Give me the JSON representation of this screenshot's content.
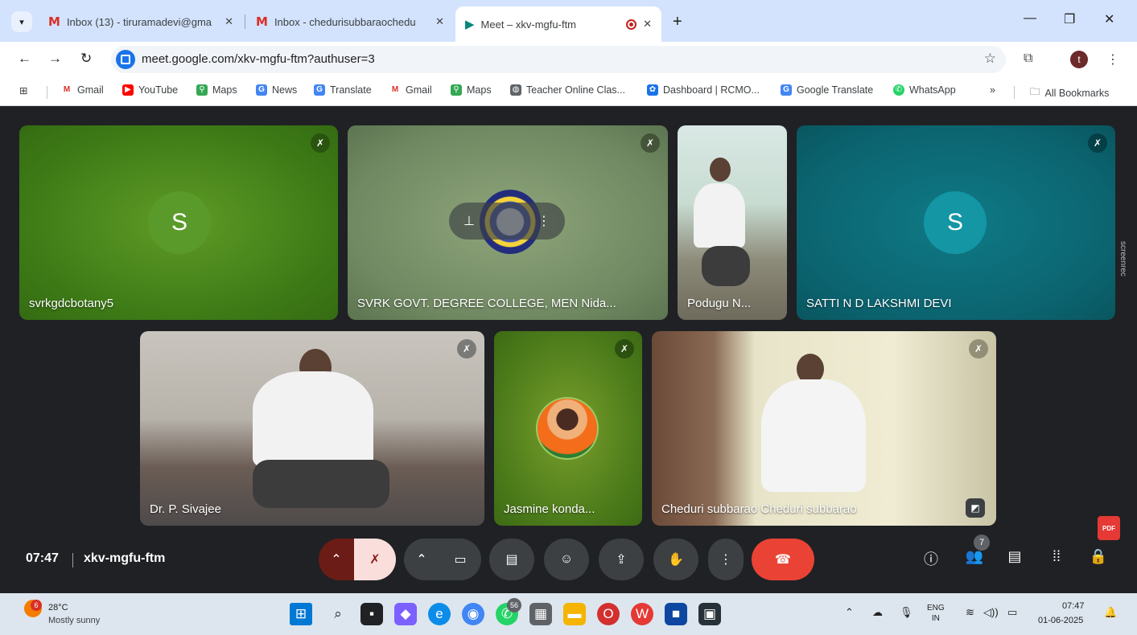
{
  "browser": {
    "tabs": [
      {
        "label": "Inbox (13) - tiruramadevi@gma",
        "icon": "gmail-icon"
      },
      {
        "label": "Inbox - chedurisubbaraochedu",
        "icon": "gmail-icon"
      },
      {
        "label": "Meet – xkv-mgfu-ftm",
        "icon": "meet-icon",
        "active": true,
        "recording": true
      }
    ],
    "url": "meet.google.com/xkv-mgfu-ftm?authuser=3",
    "profile_initial": "t",
    "bookmarks": [
      "Gmail",
      "YouTube",
      "Maps",
      "News",
      "Translate",
      "Gmail",
      "Maps",
      "Teacher Online Clas...",
      "Dashboard | RCMO...",
      "Google Translate",
      "WhatsApp"
    ],
    "bookmarks_more": "»",
    "all_bookmarks": "All Bookmarks"
  },
  "meet": {
    "participants": [
      {
        "name": "svrkgdcbotany5",
        "avatar_letter": "S",
        "muted": true
      },
      {
        "name": "SVRK GOVT. DEGREE COLLEGE, MEN Nida...",
        "muted": true
      },
      {
        "name": "Podugu N...",
        "muted": false
      },
      {
        "name": "SATTI N D LAKSHMI DEVI",
        "avatar_letter": "S",
        "muted": true
      },
      {
        "name": "Dr. P. Sivajee",
        "muted": true
      },
      {
        "name": "Jasmine konda...",
        "muted": true
      },
      {
        "name": "Cheduri subbarao Cheduri subbarao",
        "muted": true
      }
    ],
    "time": "07:47",
    "meeting_code": "xkv-mgfu-ftm",
    "people_count": "7",
    "side_label": "screenrec",
    "pdf_label": "PDF"
  },
  "taskbar": {
    "weather_temp": "28°C",
    "weather_desc": "Mostly sunny",
    "weather_badge": "6",
    "chrome_badge": "",
    "whatsapp_badge": "56",
    "language_line1": "ENG",
    "language_line2": "IN",
    "clock_time": "07:47",
    "clock_date": "01-06-2025"
  },
  "colors": {
    "tab_strip": "#d3e3fd",
    "meet_background": "#202124",
    "end_call": "#ea4335",
    "mic_off": "#f9dedc"
  }
}
